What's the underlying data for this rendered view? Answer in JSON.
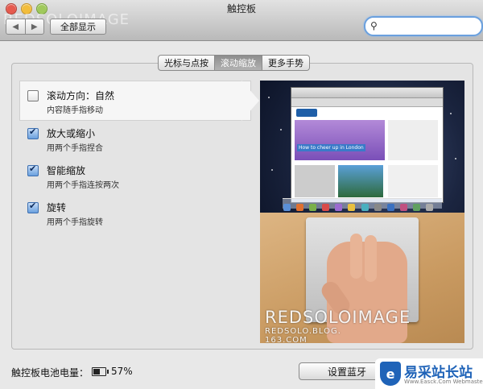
{
  "window": {
    "title": "触控板"
  },
  "toolbar": {
    "back_icon": "◀",
    "forward_icon": "▶",
    "show_all_label": "全部显示",
    "search": {
      "value": "",
      "placeholder": ""
    }
  },
  "tabs": [
    {
      "label": "光标与点按",
      "active": false
    },
    {
      "label": "滚动缩放",
      "active": true
    },
    {
      "label": "更多手势",
      "active": false
    }
  ],
  "options": [
    {
      "title": "滚动方向：自然",
      "subtitle": "内容随手指移动",
      "checked": false
    },
    {
      "title": "放大或缩小",
      "subtitle": "用两个手指捏合",
      "checked": true
    },
    {
      "title": "智能缩放",
      "subtitle": "用两个手指连按两次",
      "checked": true
    },
    {
      "title": "旋转",
      "subtitle": "用两个手指旋转",
      "checked": true
    }
  ],
  "preview": {
    "browser_banner": "How to cheer up in London",
    "watermark_main": "REDSOLOIMAGE",
    "watermark_sub_1": "REDSOLO.BLOG.",
    "watermark_sub_2": "163.COM"
  },
  "top_watermark": "REDSOLOIMAGE",
  "footer": {
    "battery_label": "触控板电池电量：",
    "battery_percent": "57%",
    "battery_level": 0.57,
    "setup_button": "设置蓝牙"
  },
  "site_logo": {
    "name": "易采站长站",
    "url": "Www.Easck.Com Webmaster"
  },
  "colors": {
    "accent": "#6aa0de",
    "logo_blue": "#1f63b8"
  }
}
